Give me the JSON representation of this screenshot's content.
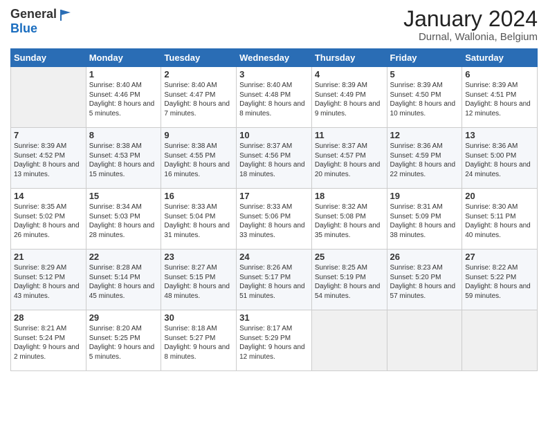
{
  "logo": {
    "general": "General",
    "blue": "Blue"
  },
  "header": {
    "month": "January 2024",
    "location": "Durnal, Wallonia, Belgium"
  },
  "days_of_week": [
    "Sunday",
    "Monday",
    "Tuesday",
    "Wednesday",
    "Thursday",
    "Friday",
    "Saturday"
  ],
  "weeks": [
    [
      {
        "day": "",
        "sunrise": "",
        "sunset": "",
        "daylight": ""
      },
      {
        "day": "1",
        "sunrise": "Sunrise: 8:40 AM",
        "sunset": "Sunset: 4:46 PM",
        "daylight": "Daylight: 8 hours and 5 minutes."
      },
      {
        "day": "2",
        "sunrise": "Sunrise: 8:40 AM",
        "sunset": "Sunset: 4:47 PM",
        "daylight": "Daylight: 8 hours and 7 minutes."
      },
      {
        "day": "3",
        "sunrise": "Sunrise: 8:40 AM",
        "sunset": "Sunset: 4:48 PM",
        "daylight": "Daylight: 8 hours and 8 minutes."
      },
      {
        "day": "4",
        "sunrise": "Sunrise: 8:39 AM",
        "sunset": "Sunset: 4:49 PM",
        "daylight": "Daylight: 8 hours and 9 minutes."
      },
      {
        "day": "5",
        "sunrise": "Sunrise: 8:39 AM",
        "sunset": "Sunset: 4:50 PM",
        "daylight": "Daylight: 8 hours and 10 minutes."
      },
      {
        "day": "6",
        "sunrise": "Sunrise: 8:39 AM",
        "sunset": "Sunset: 4:51 PM",
        "daylight": "Daylight: 8 hours and 12 minutes."
      }
    ],
    [
      {
        "day": "7",
        "sunrise": "Sunrise: 8:39 AM",
        "sunset": "Sunset: 4:52 PM",
        "daylight": "Daylight: 8 hours and 13 minutes."
      },
      {
        "day": "8",
        "sunrise": "Sunrise: 8:38 AM",
        "sunset": "Sunset: 4:53 PM",
        "daylight": "Daylight: 8 hours and 15 minutes."
      },
      {
        "day": "9",
        "sunrise": "Sunrise: 8:38 AM",
        "sunset": "Sunset: 4:55 PM",
        "daylight": "Daylight: 8 hours and 16 minutes."
      },
      {
        "day": "10",
        "sunrise": "Sunrise: 8:37 AM",
        "sunset": "Sunset: 4:56 PM",
        "daylight": "Daylight: 8 hours and 18 minutes."
      },
      {
        "day": "11",
        "sunrise": "Sunrise: 8:37 AM",
        "sunset": "Sunset: 4:57 PM",
        "daylight": "Daylight: 8 hours and 20 minutes."
      },
      {
        "day": "12",
        "sunrise": "Sunrise: 8:36 AM",
        "sunset": "Sunset: 4:59 PM",
        "daylight": "Daylight: 8 hours and 22 minutes."
      },
      {
        "day": "13",
        "sunrise": "Sunrise: 8:36 AM",
        "sunset": "Sunset: 5:00 PM",
        "daylight": "Daylight: 8 hours and 24 minutes."
      }
    ],
    [
      {
        "day": "14",
        "sunrise": "Sunrise: 8:35 AM",
        "sunset": "Sunset: 5:02 PM",
        "daylight": "Daylight: 8 hours and 26 minutes."
      },
      {
        "day": "15",
        "sunrise": "Sunrise: 8:34 AM",
        "sunset": "Sunset: 5:03 PM",
        "daylight": "Daylight: 8 hours and 28 minutes."
      },
      {
        "day": "16",
        "sunrise": "Sunrise: 8:33 AM",
        "sunset": "Sunset: 5:04 PM",
        "daylight": "Daylight: 8 hours and 31 minutes."
      },
      {
        "day": "17",
        "sunrise": "Sunrise: 8:33 AM",
        "sunset": "Sunset: 5:06 PM",
        "daylight": "Daylight: 8 hours and 33 minutes."
      },
      {
        "day": "18",
        "sunrise": "Sunrise: 8:32 AM",
        "sunset": "Sunset: 5:08 PM",
        "daylight": "Daylight: 8 hours and 35 minutes."
      },
      {
        "day": "19",
        "sunrise": "Sunrise: 8:31 AM",
        "sunset": "Sunset: 5:09 PM",
        "daylight": "Daylight: 8 hours and 38 minutes."
      },
      {
        "day": "20",
        "sunrise": "Sunrise: 8:30 AM",
        "sunset": "Sunset: 5:11 PM",
        "daylight": "Daylight: 8 hours and 40 minutes."
      }
    ],
    [
      {
        "day": "21",
        "sunrise": "Sunrise: 8:29 AM",
        "sunset": "Sunset: 5:12 PM",
        "daylight": "Daylight: 8 hours and 43 minutes."
      },
      {
        "day": "22",
        "sunrise": "Sunrise: 8:28 AM",
        "sunset": "Sunset: 5:14 PM",
        "daylight": "Daylight: 8 hours and 45 minutes."
      },
      {
        "day": "23",
        "sunrise": "Sunrise: 8:27 AM",
        "sunset": "Sunset: 5:15 PM",
        "daylight": "Daylight: 8 hours and 48 minutes."
      },
      {
        "day": "24",
        "sunrise": "Sunrise: 8:26 AM",
        "sunset": "Sunset: 5:17 PM",
        "daylight": "Daylight: 8 hours and 51 minutes."
      },
      {
        "day": "25",
        "sunrise": "Sunrise: 8:25 AM",
        "sunset": "Sunset: 5:19 PM",
        "daylight": "Daylight: 8 hours and 54 minutes."
      },
      {
        "day": "26",
        "sunrise": "Sunrise: 8:23 AM",
        "sunset": "Sunset: 5:20 PM",
        "daylight": "Daylight: 8 hours and 57 minutes."
      },
      {
        "day": "27",
        "sunrise": "Sunrise: 8:22 AM",
        "sunset": "Sunset: 5:22 PM",
        "daylight": "Daylight: 8 hours and 59 minutes."
      }
    ],
    [
      {
        "day": "28",
        "sunrise": "Sunrise: 8:21 AM",
        "sunset": "Sunset: 5:24 PM",
        "daylight": "Daylight: 9 hours and 2 minutes."
      },
      {
        "day": "29",
        "sunrise": "Sunrise: 8:20 AM",
        "sunset": "Sunset: 5:25 PM",
        "daylight": "Daylight: 9 hours and 5 minutes."
      },
      {
        "day": "30",
        "sunrise": "Sunrise: 8:18 AM",
        "sunset": "Sunset: 5:27 PM",
        "daylight": "Daylight: 9 hours and 8 minutes."
      },
      {
        "day": "31",
        "sunrise": "Sunrise: 8:17 AM",
        "sunset": "Sunset: 5:29 PM",
        "daylight": "Daylight: 9 hours and 12 minutes."
      },
      {
        "day": "",
        "sunrise": "",
        "sunset": "",
        "daylight": ""
      },
      {
        "day": "",
        "sunrise": "",
        "sunset": "",
        "daylight": ""
      },
      {
        "day": "",
        "sunrise": "",
        "sunset": "",
        "daylight": ""
      }
    ]
  ]
}
